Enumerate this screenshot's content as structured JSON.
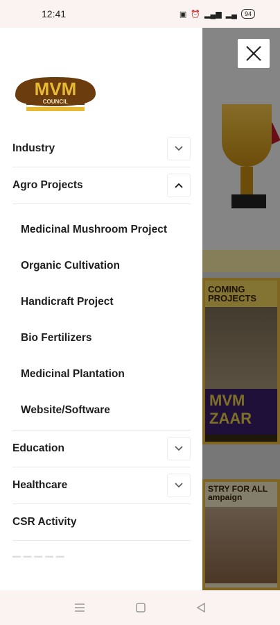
{
  "status_bar": {
    "time": "12:41",
    "battery": "94"
  },
  "logo": {
    "brand": "MVM",
    "subtitle": "COUNCIL"
  },
  "menu": {
    "industry": "Industry",
    "agro_projects": "Agro Projects",
    "agro_sub": [
      "Medicinal Mushroom Project",
      "Organic Cultivation",
      "Handicraft Project",
      "Bio Fertilizers",
      "Medicinal Plantation",
      "Website/Software"
    ],
    "education": "Education",
    "healthcare": "Healthcare",
    "csr": "CSR Activity"
  },
  "background": {
    "upcoming_title": "COMING PROJECTS",
    "mvm_brand": "MVM ZAAR",
    "industry_title": "STRY FOR ALL ampaign"
  },
  "icons": {
    "close": "close-icon",
    "chevron_down": "chevron-down-icon",
    "chevron_up": "chevron-up-icon",
    "nav_menu": "menu-icon",
    "nav_home": "home-icon",
    "nav_back": "back-icon"
  },
  "colors": {
    "logo_brown": "#6b3d0e",
    "logo_gold": "#e8b933",
    "text": "#1e1e1e"
  }
}
